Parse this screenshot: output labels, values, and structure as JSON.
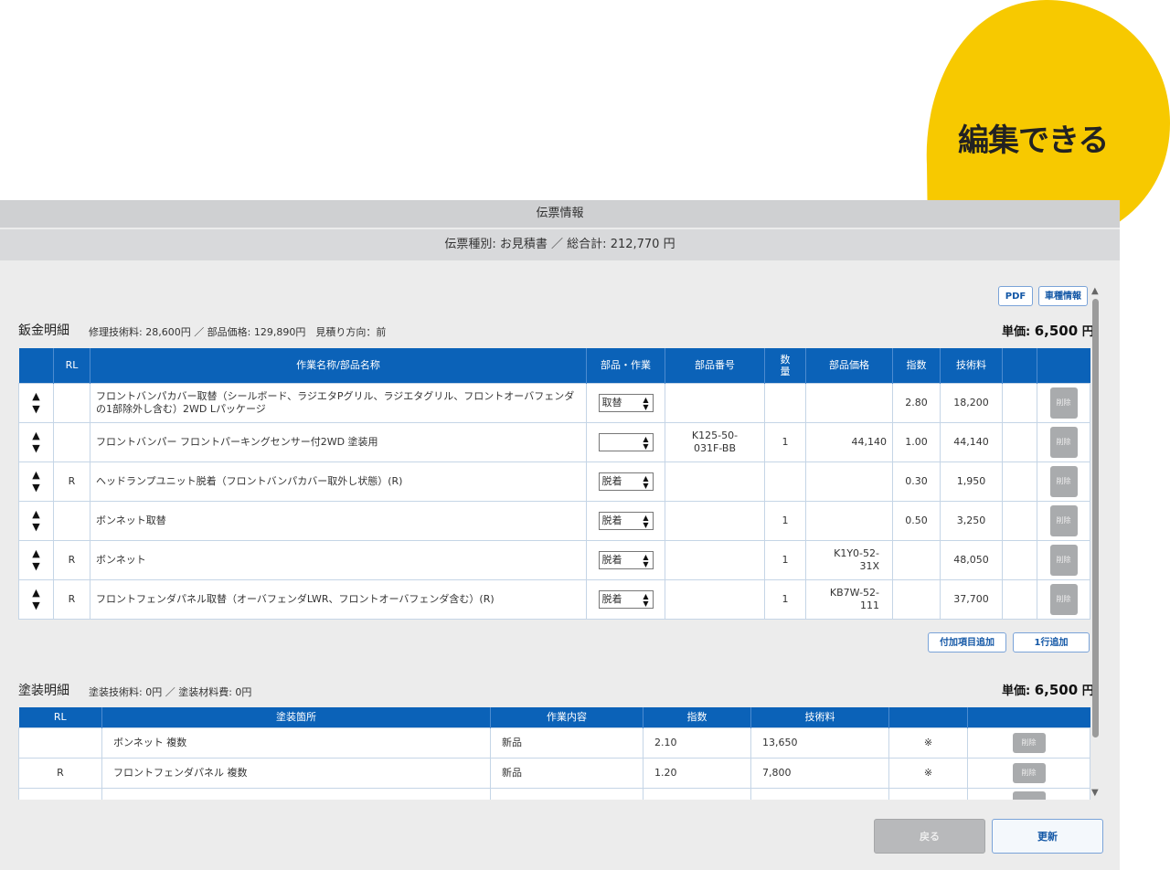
{
  "callout": {
    "text": "編集できる"
  },
  "window": {
    "title": "伝票情報",
    "summary": "伝票種別: お見積書 ／ 総合計: 212,770 円"
  },
  "toolbar": {
    "pdf_label": "PDF",
    "vehicle_info_label": "車種情報"
  },
  "sheet_metal": {
    "title": "鈑金明細",
    "subtitle": "修理技術料: 28,600円 ／ 部品価格: 129,890円　見積り方向：前",
    "unit_price_label": "単価: ",
    "unit_price_value": "6,500",
    "unit_price_suffix": " 円",
    "columns": [
      "",
      "RL",
      "作業名称/部品名称",
      "部品・作業",
      "部品番号",
      "数量",
      "部品価格",
      "指数",
      "技術料",
      "",
      ""
    ],
    "rows": [
      {
        "rl": "",
        "name": "フロントバンパカバー取替（シールボード、ラジエタPグリル、ラジエタグリル、フロントオーバフェンダの1部除外し含む）2WD Lパッケージ",
        "op": "取替",
        "part_no": "",
        "qty": "",
        "price": "",
        "index": "2.80",
        "fee": "18,200"
      },
      {
        "rl": "",
        "name": "フロントバンパー フロントパーキングセンサー付2WD 塗装用",
        "op": "",
        "part_no": "K125-50-031F-BB",
        "qty": "1",
        "price": "44,140",
        "index": "1.00",
        "fee": "44,140"
      },
      {
        "rl": "R",
        "name": "ヘッドランプユニット脱着（フロントバンパカバー取外し状態）(R)",
        "op": "脱着",
        "part_no": "",
        "qty": "",
        "price": "",
        "index": "0.30",
        "fee": "1,950"
      },
      {
        "rl": "",
        "name": "ボンネット取替",
        "op": "脱着",
        "part_no": "",
        "qty": "1",
        "price": "",
        "index": "0.50",
        "fee": "3,250"
      },
      {
        "rl": "R",
        "name": "ボンネット",
        "op": "脱着",
        "part_no": "",
        "qty": "1",
        "price": "K1Y0-52-31X",
        "index": "",
        "fee": "48,050"
      },
      {
        "rl": "R",
        "name": "フロントフェンダパネル取替（オーバフェンダLWR、フロントオーバフェンダ含む）(R)",
        "op": "脱着",
        "part_no": "",
        "qty": "1",
        "price": "KB7W-52-111",
        "index": "",
        "fee": "37,700"
      }
    ],
    "delete_label": "削除",
    "add_extra_label": "付加項目追加",
    "add_row_label": "1行追加"
  },
  "paint": {
    "title": "塗装明細",
    "subtitle": "塗装技術料: 0円 ／ 塗装材料費: 0円",
    "unit_price_label": "単価: ",
    "unit_price_value": "6,500",
    "unit_price_suffix": " 円",
    "columns": [
      "RL",
      "塗装箇所",
      "作業内容",
      "指数",
      "技術料",
      "",
      ""
    ],
    "rows": [
      {
        "rl": "",
        "place": "ボンネット 複数",
        "work": "新品",
        "index": "2.10",
        "fee": "13,650",
        "mark": "※"
      },
      {
        "rl": "R",
        "place": "フロントフェンダパネル 複数",
        "work": "新品",
        "index": "1.20",
        "fee": "7,800",
        "mark": "※"
      }
    ],
    "delete_label": "削除"
  },
  "footer": {
    "back_label": "戻る",
    "update_label": "更新"
  },
  "colors": {
    "header_blue": "#0b62b8",
    "callout_yellow": "#f7c900"
  }
}
